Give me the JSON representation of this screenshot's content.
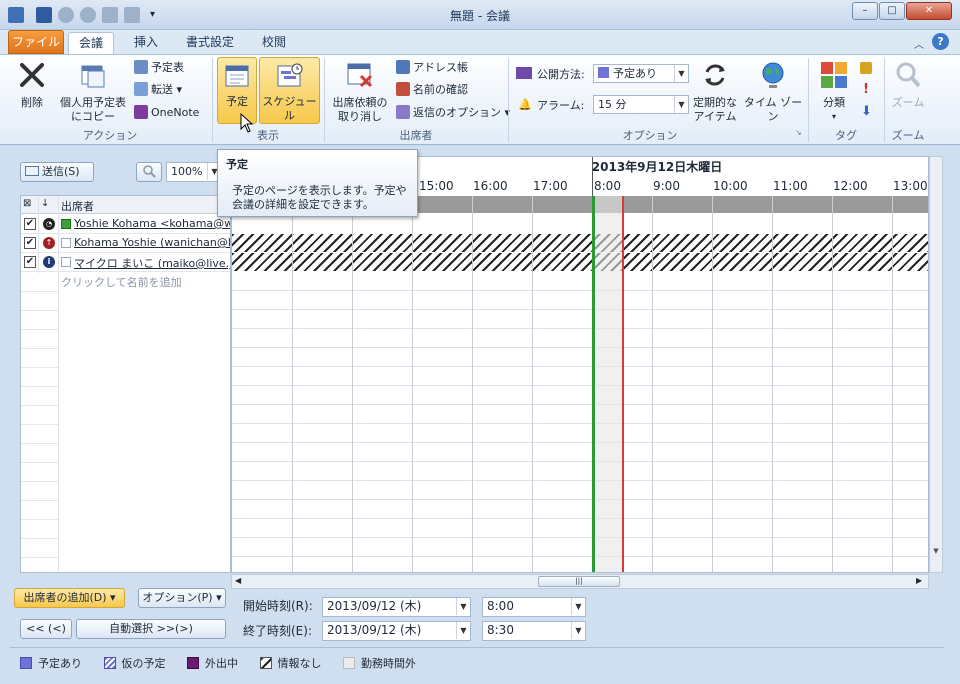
{
  "window": {
    "title": "無題 - 会議"
  },
  "tabs": [
    "ファイル",
    "会議",
    "挿入",
    "書式設定",
    "校閲"
  ],
  "ribbon": {
    "delete": "削除",
    "copy_personal": [
      "個人用予定表",
      "にコピー"
    ],
    "calendar": "予定表",
    "forward": "転送",
    "onenote": "OneNote",
    "group_action": "アクション",
    "view_appointment": "予定",
    "view_schedule": "スケジュール",
    "group_view": "表示",
    "cancel_invite": [
      "出席依頼の",
      "取り消し"
    ],
    "address_book": "アドレス帳",
    "check_names": "名前の確認",
    "reply_options": "返信のオプション",
    "group_attendees": "出席者",
    "show_as_label": "公開方法:",
    "show_as_value": "予定あり",
    "reminder_label": "アラーム:",
    "reminder_value": "15 分",
    "recurrence": [
      "定期的な",
      "アイテム"
    ],
    "time_zone": "タイム ゾーン",
    "group_options": "オプション",
    "categorize": "分類",
    "group_tags": "タグ",
    "zoom": "ズーム",
    "group_zoom": "ズーム"
  },
  "tooltip": {
    "title": "予定",
    "body": [
      "予定のページを表示します。予定や",
      "会議の詳細を設定できます。"
    ]
  },
  "toolbar": {
    "send": "送信(S)",
    "zoom": "100%"
  },
  "schedule": {
    "date": "2013年9月12日木曜日",
    "times": [
      "15:00",
      "16:00",
      "17:00",
      "8:00",
      "9:00",
      "10:00",
      "11:00",
      "12:00",
      "13:00"
    ],
    "attendees_header": "出席者",
    "attendees": [
      {
        "name": "Yoshie Kohama <kohama@wan",
        "status": "busy"
      },
      {
        "name": "Kohama Yoshie (wanichan@liv",
        "status": "required"
      },
      {
        "name": "マイクロ まいこ (maiko@live.jp)",
        "status": "info"
      }
    ],
    "add_name": "クリックして名前を追加"
  },
  "bottom": {
    "add_attendees": "出席者の追加(D)",
    "options": "オプション(P)",
    "prev": "<< (<)",
    "auto_pick": "自動選択 >>(>)",
    "start_label": "開始時刻(R):",
    "start_date": "2013/09/12 (木)",
    "start_time": "8:00",
    "end_label": "終了時刻(E):",
    "end_date": "2013/09/12 (木)",
    "end_time": "8:30"
  },
  "legend": [
    "予定あり",
    "仮の予定",
    "外出中",
    "情報なし",
    "勤務時間外"
  ],
  "colors": {
    "busy": "#6f72d8",
    "oof": "#6a1a72",
    "start_line": "#2a9a35",
    "end_line": "#d63a3a"
  }
}
